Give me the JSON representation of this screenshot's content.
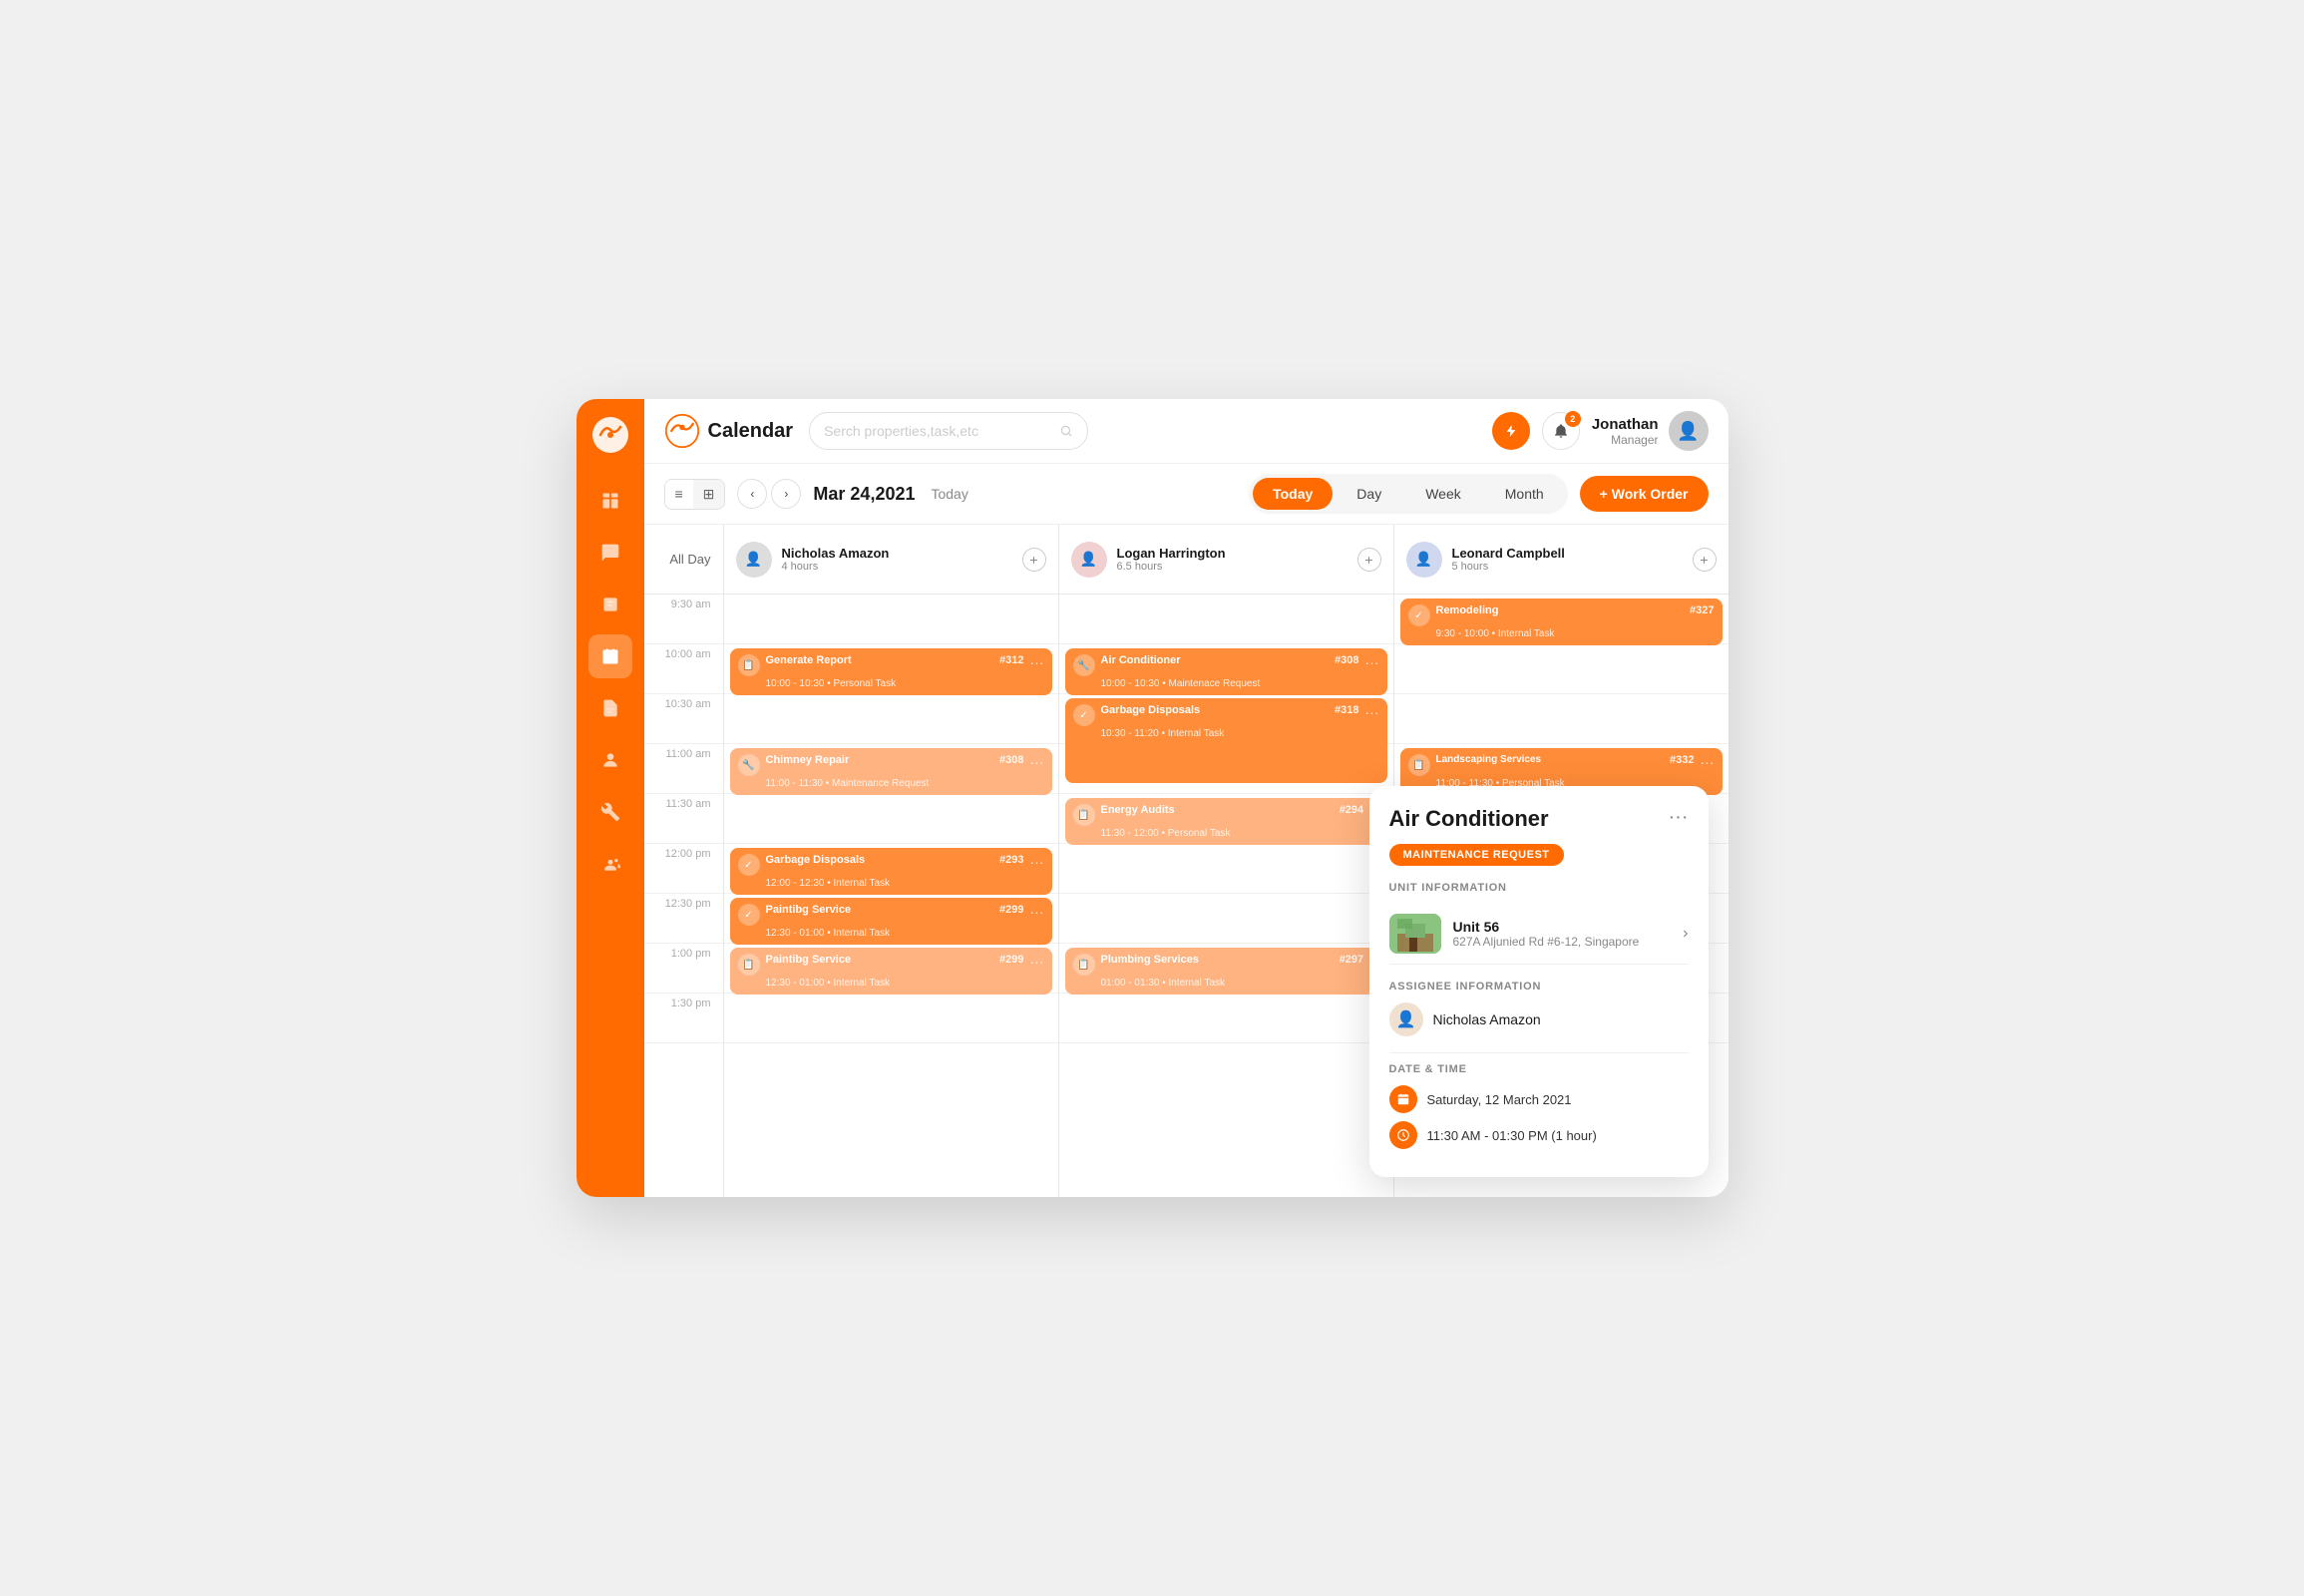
{
  "header": {
    "title": "Calendar",
    "search_placeholder": "Serch properties,task,etc",
    "user": {
      "name": "Jonathan",
      "role": "Manager"
    },
    "notifications_count": "2"
  },
  "toolbar": {
    "date": "Mar 24,2021",
    "today_label": "Today",
    "tabs": [
      "Today",
      "Day",
      "Week",
      "Month"
    ],
    "work_order_label": "+ Work Order",
    "active_tab": "Today"
  },
  "calendar": {
    "all_day_label": "All Day",
    "columns": [
      {
        "name": "Nicholas Amazon",
        "hours": "4 hours",
        "events": [
          {
            "title": "Generate Report",
            "num": "#312",
            "time": "10:00 - 10:30",
            "type": "Personal Task",
            "icon": "📋",
            "row": 1
          },
          {
            "title": "Chimney Repair",
            "num": "#308",
            "time": "11:00 - 11:30",
            "type": "Maintenance Request",
            "icon": "🔧",
            "row": 3
          },
          {
            "title": "Garbage Disposals",
            "num": "#293",
            "time": "12:00 - 12:30",
            "type": "Internal Task",
            "icon": "✓",
            "row": 5
          },
          {
            "title": "Paintibg Service",
            "num": "#299",
            "time": "12:30 - 01:00",
            "type": "Internal Task",
            "icon": "✓",
            "row": 6
          },
          {
            "title": "Paintibg Service",
            "num": "#299",
            "time": "12:30 - 01:00",
            "type": "Internal Task",
            "icon": "📋",
            "row": 7
          }
        ]
      },
      {
        "name": "Logan Harrington",
        "hours": "6.5 hours",
        "events": [
          {
            "title": "Air Conditioner",
            "num": "#308",
            "time": "10:00 - 10:30",
            "type": "Maintenace Request",
            "icon": "🔧",
            "row": 0
          },
          {
            "title": "Garbage Disposals",
            "num": "#318",
            "time": "10:30 - 11:20",
            "type": "Internal Task",
            "icon": "✓",
            "row": 1
          },
          {
            "title": "Energy Audits",
            "num": "#294",
            "time": "11:30 - 12:00",
            "type": "Personal Task",
            "icon": "📋",
            "row": 4
          },
          {
            "title": "Plumbing Services",
            "num": "#297",
            "time": "01:00 - 01:30",
            "type": "Internal Task",
            "icon": "📋",
            "row": 8
          }
        ]
      },
      {
        "name": "Leonard Campbell",
        "hours": "5 hours",
        "events": [
          {
            "title": "Remodeling",
            "num": "#327",
            "time": "9:30 - 10:00",
            "type": "Internal Task",
            "icon": "✓",
            "row": -1
          },
          {
            "title": "Landscaping Services",
            "num": "#332",
            "time": "11:00 - 11:30",
            "type": "Personal Task",
            "icon": "📋",
            "row": 3
          }
        ]
      }
    ],
    "time_slots": [
      "9:30 am",
      "10:00 am",
      "10:30 am",
      "11:00 am",
      "11:30 am",
      "12:00 pm",
      "12:30 pm",
      "1:00 pm",
      "1:30 pm"
    ]
  },
  "popup": {
    "title": "Air Conditioner",
    "badge": "MAINTENANCE REQUEST",
    "unit_section": "UNIT INFORMATION",
    "unit_name": "Unit 56",
    "unit_address": "627A Aljunied Rd #6-12, Singapore",
    "assignee_section": "Assignee Information",
    "assignee_name": "Nicholas Amazon",
    "date_section": "DATE & TIME",
    "date": "Saturday, 12 March 2021",
    "time": "11:30 AM - 01:30 PM (1 hour)"
  }
}
